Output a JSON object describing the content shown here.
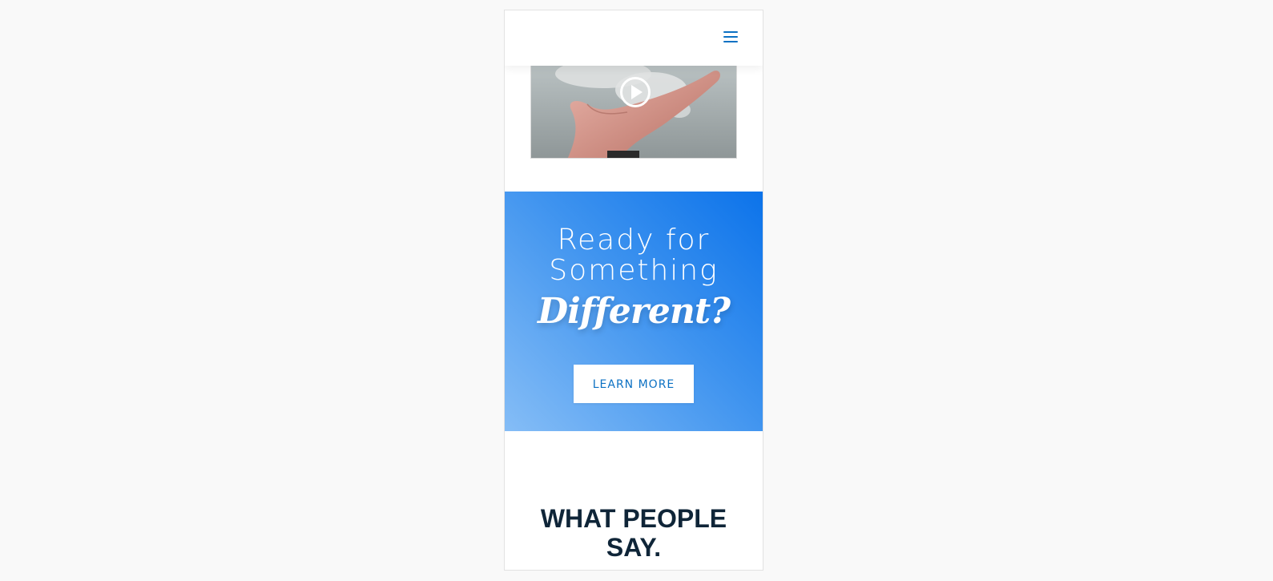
{
  "header": {
    "menu_icon": "hamburger-menu-icon",
    "accent_color": "#0c71c3"
  },
  "video": {
    "play_icon": "play-circle-icon"
  },
  "cta": {
    "line1": "Ready for",
    "line2": "Something",
    "script_word": "Different?",
    "button_label": "LEARN MORE",
    "gradient_colors": [
      "#0c73ea",
      "#85bdf6"
    ]
  },
  "testimonials": {
    "title_line1": "WHAT PEOPLE",
    "title_line2": "SAY."
  }
}
